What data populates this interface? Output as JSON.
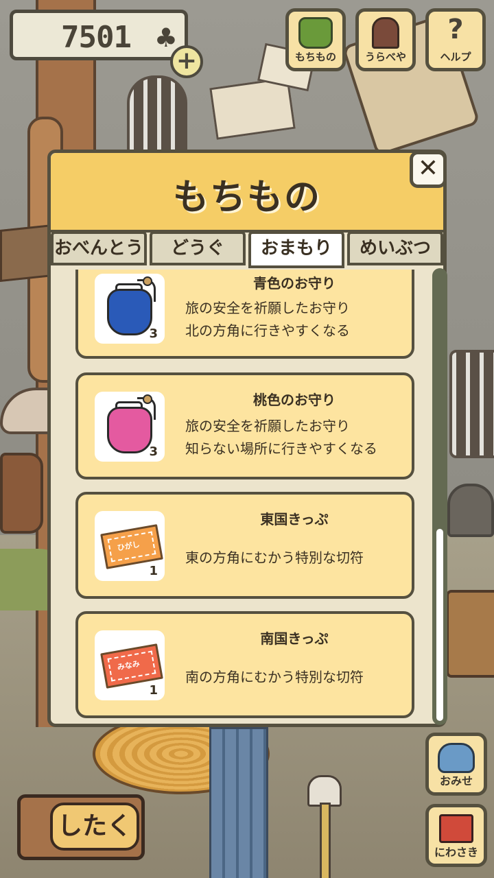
{
  "hud": {
    "clover_count": "7501",
    "clover_symbol": "♣",
    "add_symbol": "+",
    "buttons": [
      {
        "label": "もちもの",
        "icon": "bag-icon"
      },
      {
        "label": "うらべや",
        "icon": "door-icon"
      },
      {
        "label": "ヘルプ",
        "icon": "help-icon"
      }
    ]
  },
  "modal": {
    "title": "もちもの",
    "close_symbol": "✕",
    "tabs": [
      {
        "label": "おべんとう",
        "active": false
      },
      {
        "label": "どうぐ",
        "active": false
      },
      {
        "label": "おまもり",
        "active": true
      },
      {
        "label": "めいぶつ",
        "active": false
      }
    ],
    "items": [
      {
        "name": "青色のお守り",
        "desc1": "旅の安全を祈願したお守り",
        "desc2": "北の方角に行きやすくなる",
        "qty": "3",
        "icon": "blue-amulet-icon",
        "color": "#2a5ab8"
      },
      {
        "name": "桃色のお守り",
        "desc1": "旅の安全を祈願したお守り",
        "desc2": "知らない場所に行きやすくなる",
        "qty": "3",
        "icon": "pink-amulet-icon",
        "color": "#e45aa0"
      },
      {
        "name": "東国きっぷ",
        "desc1": "東の方角にむかう特別な切符",
        "desc2": "",
        "qty": "1",
        "icon": "east-ticket-icon",
        "ticket_text": "ひがし",
        "color": "#f5a04a"
      },
      {
        "name": "南国きっぷ",
        "desc1": "南の方角にむかう特別な切符",
        "desc2": "",
        "qty": "1",
        "icon": "south-ticket-icon",
        "ticket_text": "みなみ",
        "color": "#f06a4a"
      }
    ]
  },
  "bottom": {
    "prepare_label": "したく",
    "shop_label": "おみせ",
    "garden_label": "にわさき"
  }
}
